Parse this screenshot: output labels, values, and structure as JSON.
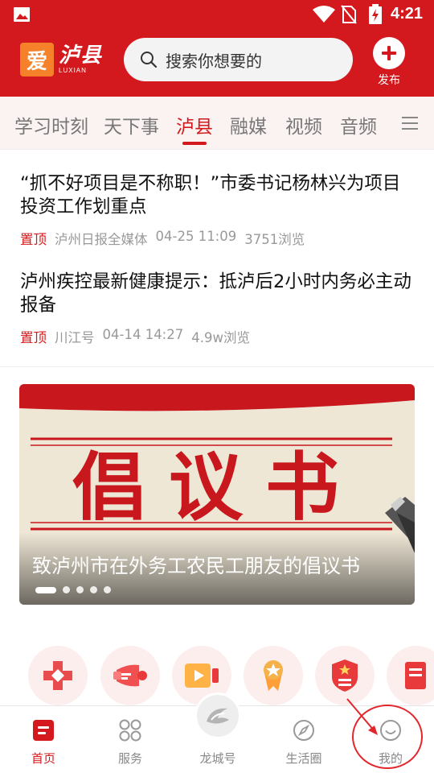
{
  "status_bar": {
    "time": "4:21"
  },
  "header": {
    "logo_char": "爱",
    "logo_name": "泸县",
    "logo_en": "LUXIAN",
    "search_placeholder": "搜索你想要的",
    "publish_label": "发布"
  },
  "tabs": [
    {
      "label": "学习时刻",
      "active": false
    },
    {
      "label": "天下事",
      "active": false
    },
    {
      "label": "泸县",
      "active": true
    },
    {
      "label": "融媒",
      "active": false
    },
    {
      "label": "视频",
      "active": false
    },
    {
      "label": "音频",
      "active": false
    }
  ],
  "news": [
    {
      "title": "“抓不好项目是不称职！”市委书记杨林兴为项目投资工作划重点",
      "pin": "置顶",
      "source": "泸州日报全媒体",
      "time": "04-25 11:09",
      "views": "3751浏览"
    },
    {
      "title": "泸州疾控最新健康提示：抵泸后2小时内务必主动报备",
      "pin": "置顶",
      "source": "川江号",
      "time": "04-14 14:27",
      "views": "4.9w浏览"
    }
  ],
  "banner": {
    "art_text": "倡议书",
    "caption": "致泸州市在外务工农民工朋友的倡议书",
    "slide_count": 5,
    "active_slide": 1
  },
  "quick_entries": [
    {
      "icon": "medical-cross-icon"
    },
    {
      "icon": "megaphone-icon"
    },
    {
      "icon": "video-play-icon"
    },
    {
      "icon": "star-medal-icon"
    },
    {
      "icon": "party-badge-icon"
    },
    {
      "icon": "document-icon"
    }
  ],
  "bottom_nav": [
    {
      "label": "首页",
      "icon": "home-icon",
      "active": true
    },
    {
      "label": "服务",
      "icon": "grid-icon",
      "active": false
    },
    {
      "label": "龙城号",
      "icon": "longcheng-logo-icon",
      "active": false
    },
    {
      "label": "生活圈",
      "icon": "compass-icon",
      "active": false
    },
    {
      "label": "我的",
      "icon": "smile-icon",
      "active": false
    }
  ],
  "colors": {
    "brand_red": "#d3191d",
    "logo_orange": "#f5822a",
    "annotation_red": "#e3262c"
  }
}
